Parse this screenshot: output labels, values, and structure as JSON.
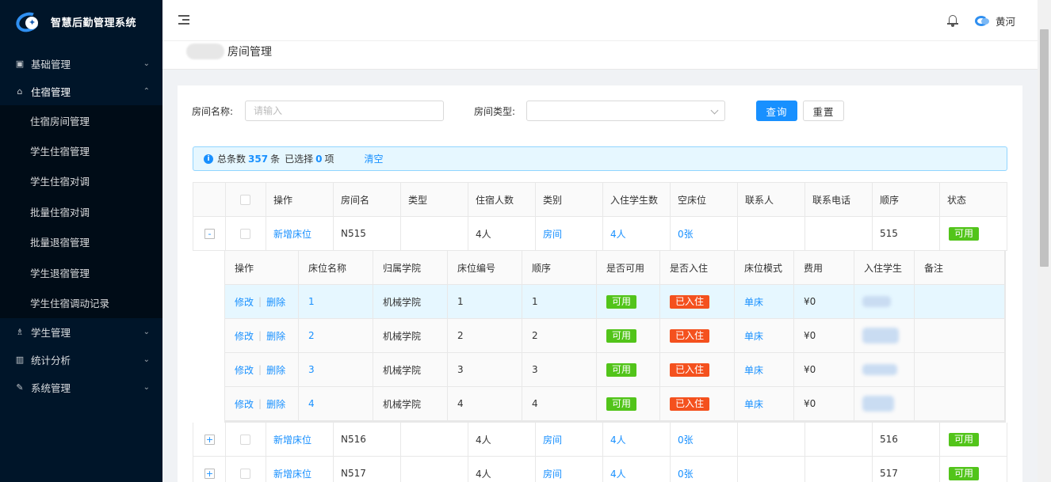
{
  "app": {
    "title": "智慧后勤管理系统"
  },
  "sidebar": {
    "items": [
      {
        "label": "基础管理",
        "icon": "square-icon",
        "expanded": false
      },
      {
        "label": "住宿管理",
        "icon": "home-icon",
        "expanded": true
      },
      {
        "label": "学生管理",
        "icon": "users-icon",
        "expanded": false
      },
      {
        "label": "统计分析",
        "icon": "bar-chart-icon",
        "expanded": false
      },
      {
        "label": "系统管理",
        "icon": "wrench-icon",
        "expanded": false
      }
    ],
    "submenu": [
      "住宿房间管理",
      "学生住宿管理",
      "学生住宿对调",
      "批量住宿对调",
      "批量退宿管理",
      "学生退宿管理",
      "学生住宿调动记录"
    ]
  },
  "header": {
    "user_name": "黄河"
  },
  "breadcrumb": {
    "title": "房间管理"
  },
  "search": {
    "room_name_label": "房间名称:",
    "room_name_placeholder": "请输入",
    "room_type_label": "房间类型:",
    "query_button": "查询",
    "reset_button": "重置"
  },
  "alert": {
    "prefix": "总条数",
    "total": "357",
    "unit": "条",
    "selected_prefix": "已选择",
    "selected": "0",
    "selected_unit": "项",
    "clear": "清空"
  },
  "table": {
    "columns": [
      "操作",
      "房间名",
      "类型",
      "住宿人数",
      "类别",
      "入住学生数",
      "空床位",
      "联系人",
      "联系电话",
      "顺序",
      "状态"
    ],
    "rows": [
      {
        "expand": "-",
        "action": "新增床位",
        "room": "N515",
        "type": "",
        "capacity": "4人",
        "category": "房间",
        "students": "4人",
        "empty": "0张",
        "contact": "",
        "phone": "",
        "order": "515",
        "status": "可用"
      },
      {
        "expand": "+",
        "action": "新增床位",
        "room": "N516",
        "type": "",
        "capacity": "4人",
        "category": "房间",
        "students": "4人",
        "empty": "0张",
        "contact": "",
        "phone": "",
        "order": "516",
        "status": "可用"
      },
      {
        "expand": "+",
        "action": "新增床位",
        "room": "N517",
        "type": "",
        "capacity": "4人",
        "category": "房间",
        "students": "4人",
        "empty": "0张",
        "contact": "",
        "phone": "",
        "order": "517",
        "status": "可用"
      }
    ]
  },
  "subtable": {
    "columns": [
      "操作",
      "床位名称",
      "归属学院",
      "床位编号",
      "顺序",
      "是否可用",
      "是否入住",
      "床位模式",
      "费用",
      "入住学生",
      "备注"
    ],
    "edit_label": "修改",
    "delete_label": "删除",
    "rows": [
      {
        "bed": "1",
        "college": "机械学院",
        "code": "1",
        "order": "1",
        "available": "可用",
        "occupied": "已入住",
        "mode": "单床",
        "fee": "¥0",
        "note": ""
      },
      {
        "bed": "2",
        "college": "机械学院",
        "code": "2",
        "order": "2",
        "available": "可用",
        "occupied": "已入住",
        "mode": "单床",
        "fee": "¥0",
        "note": ""
      },
      {
        "bed": "3",
        "college": "机械学院",
        "code": "3",
        "order": "3",
        "available": "可用",
        "occupied": "已入住",
        "mode": "单床",
        "fee": "¥0",
        "note": ""
      },
      {
        "bed": "4",
        "college": "机械学院",
        "code": "4",
        "order": "4",
        "available": "可用",
        "occupied": "已入住",
        "mode": "单床",
        "fee": "¥0",
        "note": ""
      }
    ]
  },
  "colors": {
    "sidebar_bg": "#001529",
    "primary": "#1890ff",
    "success": "#52c41a",
    "danger": "#f4511e"
  }
}
